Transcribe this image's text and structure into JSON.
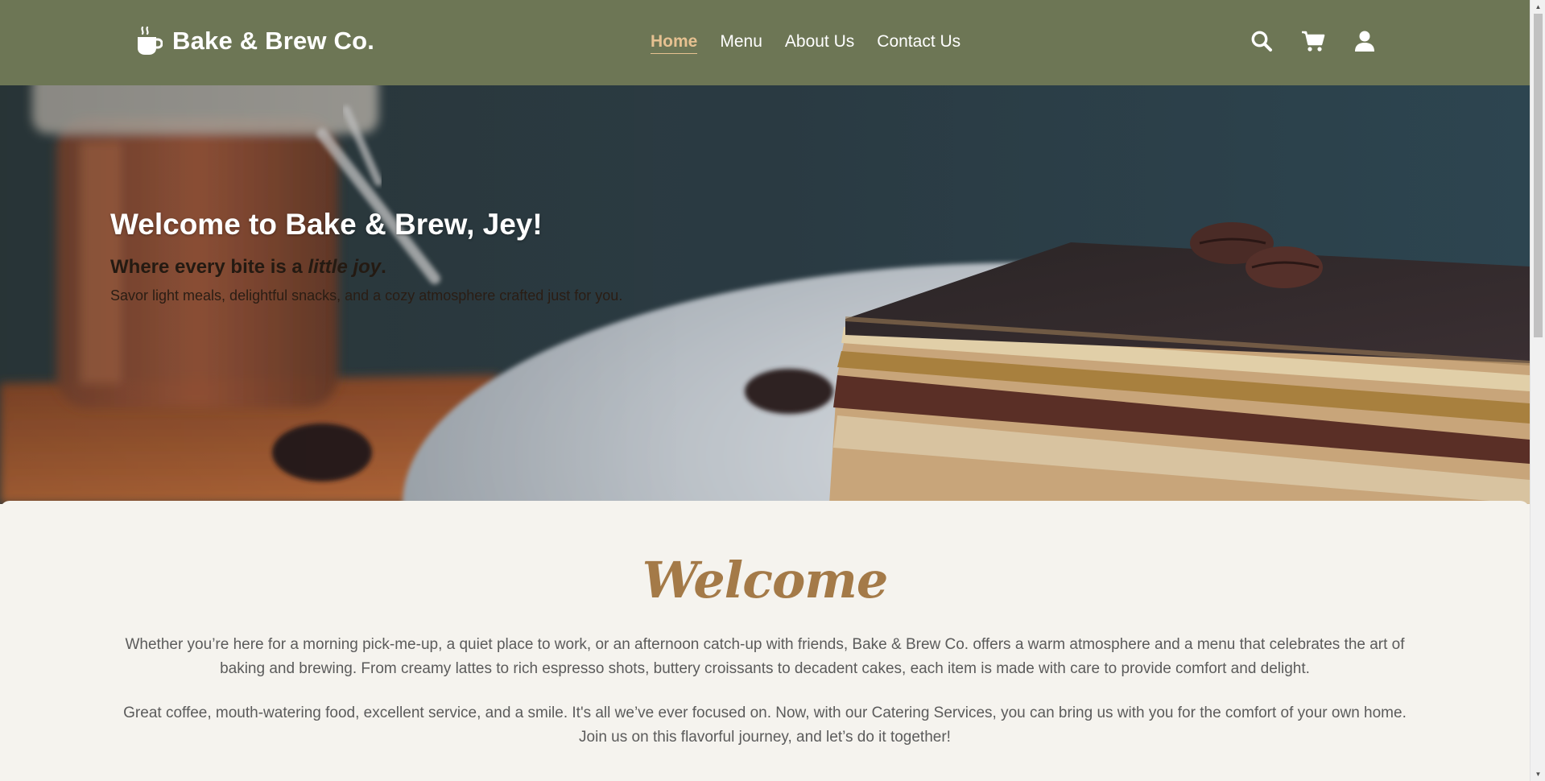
{
  "brand": {
    "name": "Bake & Brew Co.",
    "icon": "coffee-cup-icon"
  },
  "nav": {
    "items": [
      {
        "label": "Home",
        "active": true
      },
      {
        "label": "Menu",
        "active": false
      },
      {
        "label": "About Us",
        "active": false
      },
      {
        "label": "Contact Us",
        "active": false
      }
    ]
  },
  "header_icons": [
    "search-icon",
    "cart-icon",
    "user-icon"
  ],
  "hero": {
    "title": "Welcome to Bake & Brew, Jey!",
    "tagline_prefix": "Where every bite is a ",
    "tagline_emphasis": "little joy",
    "tagline_suffix": ".",
    "subtitle": "Savor light meals, delightful snacks, and a cozy atmosphere crafted just for you."
  },
  "welcome": {
    "title": "Welcome",
    "paragraph_1": "Whether you’re here for a morning pick-me-up, a quiet place to work, or an afternoon catch-up with friends, Bake & Brew Co. offers a warm atmosphere and a menu that celebrates the art of baking and brewing. From creamy lattes to rich espresso shots, buttery croissants to decadent cakes, each item is made with care to provide comfort and delight.",
    "paragraph_2": "Great coffee, mouth-watering food, excellent service, and a smile. It's all we’ve ever focused on. Now, with our Catering Services, you can bring us with you for the comfort of your own home. Join us on this flavorful journey, and let’s do it together!"
  },
  "colors": {
    "header_bg": "#6d7655",
    "nav_active": "#e6c191",
    "welcome_title": "#a47a48",
    "body_bg": "#f5f3ee"
  }
}
